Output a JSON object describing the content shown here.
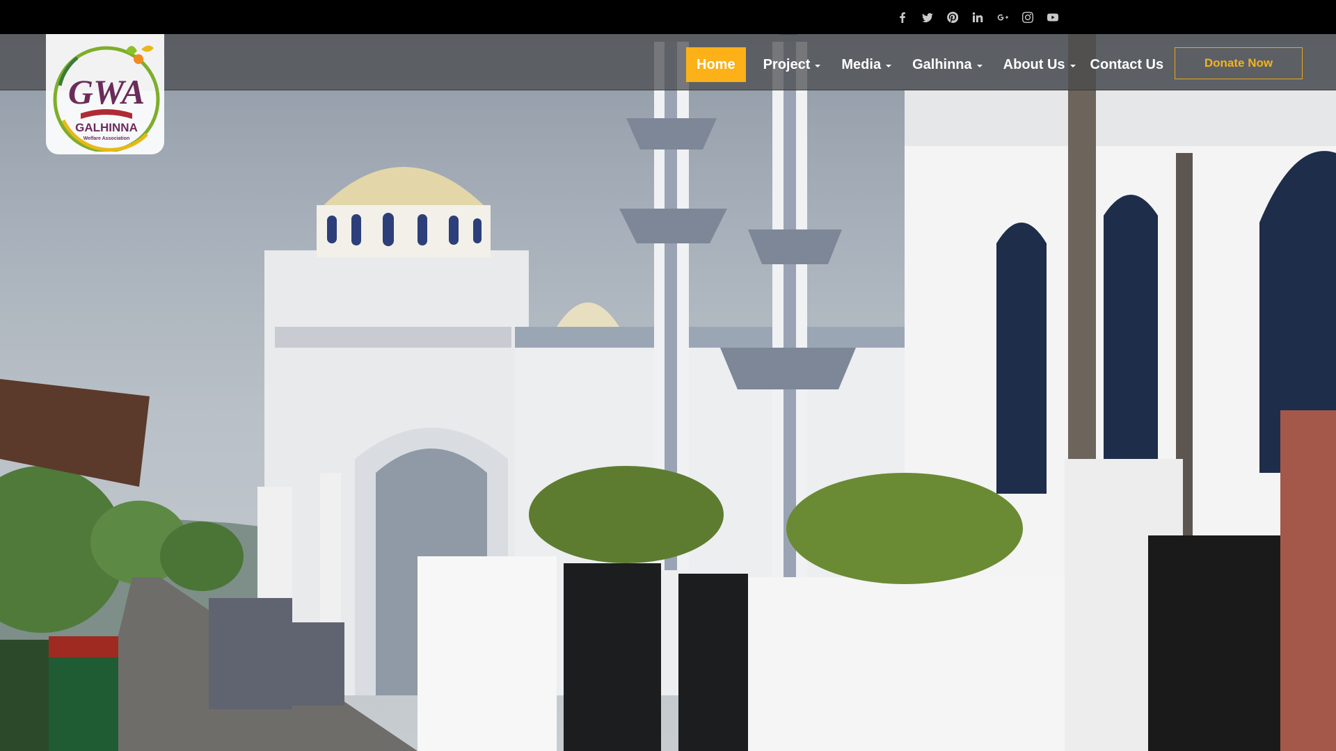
{
  "site": {
    "logo_text": "GWA",
    "logo_name": "GALHINNA",
    "logo_sub": "Welfare Association"
  },
  "social": [
    {
      "icon": "facebook-icon",
      "glyph": "f"
    },
    {
      "icon": "twitter-icon",
      "glyph": "t"
    },
    {
      "icon": "pinterest-icon",
      "glyph": "p"
    },
    {
      "icon": "linkedin-icon",
      "glyph": "in"
    },
    {
      "icon": "google-plus-icon",
      "glyph": "G+"
    },
    {
      "icon": "instagram-icon",
      "glyph": "ig"
    },
    {
      "icon": "youtube-icon",
      "glyph": "yt"
    }
  ],
  "nav": {
    "home": "Home",
    "project": "Project",
    "media": "Media",
    "galhinna": "Galhinna",
    "about": "About Us",
    "contact": "Contact Us"
  },
  "donate_label": "Donate Now",
  "colors": {
    "accent": "#fbb117",
    "topbar": "#000000",
    "donate_border": "#e6a91d"
  }
}
